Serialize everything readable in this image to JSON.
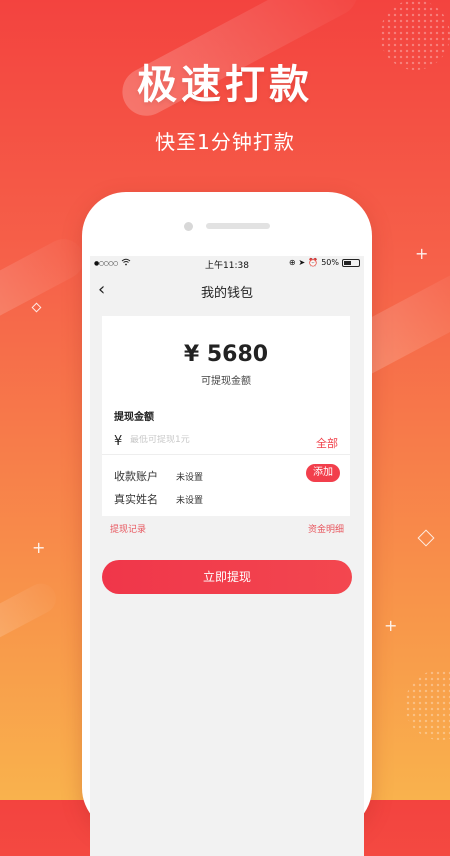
{
  "promo": {
    "headline": "极速打款",
    "subline": "快至1分钟打款"
  },
  "status_bar": {
    "signal": "●○○○○",
    "time": "上午11:38",
    "battery_percent": "50%",
    "battery_level": 0.5
  },
  "nav": {
    "back_icon": "chevron-left-icon",
    "back_glyph": "‹",
    "title": "我的钱包"
  },
  "wallet": {
    "balance": "¥ 5680",
    "balance_label": "可提现金额",
    "withdraw_title": "提现金额",
    "currency_symbol": "¥",
    "amount_placeholder": "最低可提现1元",
    "all_label": "全部",
    "account_label": "收款账户",
    "account_value": "未设置",
    "add_label": "添加",
    "name_label": "真实姓名",
    "name_value": "未设置"
  },
  "links": {
    "history": "提现记录",
    "details": "资金明细"
  },
  "submit_label": "立即提现",
  "colors": {
    "accent": "#f0414a",
    "background_top": "#f3433f",
    "background_bottom": "#f9b24d"
  }
}
